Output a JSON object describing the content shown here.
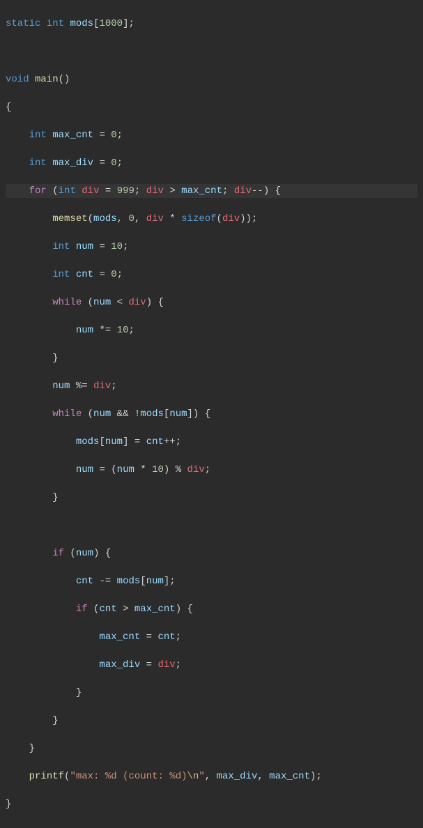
{
  "code": {
    "l1": {
      "kw1": "static",
      "type": "int",
      "var": "mods",
      "num": "1000"
    },
    "l2": {
      "type": "void",
      "func": "main"
    },
    "l3": {
      "type": "int",
      "var": "max_cnt",
      "num": "0"
    },
    "l4": {
      "type": "int",
      "var": "max_div",
      "num": "0"
    },
    "l5": {
      "for": "for",
      "type": "int",
      "div": "div",
      "n999": "999",
      "gt": ">",
      "maxcnt": "max_cnt",
      "divdec": "div",
      "dec": "--"
    },
    "l6": {
      "func": "memset",
      "mods": "mods",
      "zero": "0",
      "div": "div",
      "sizeof": "sizeof",
      "div2": "div"
    },
    "l7": {
      "type": "int",
      "var": "num",
      "num": "10"
    },
    "l8": {
      "type": "int",
      "var": "cnt",
      "num": "0"
    },
    "l9": {
      "while": "while",
      "num": "num",
      "lt": "<",
      "div": "div"
    },
    "l10": {
      "var": "num",
      "op": "*=",
      "num": "10"
    },
    "l11": {
      "text": "}"
    },
    "l12": {
      "var": "num",
      "op": "%=",
      "div": "div"
    },
    "l13": {
      "while": "while",
      "num": "num",
      "and": "&&",
      "not": "!",
      "mods": "mods",
      "num2": "num"
    },
    "l14": {
      "mods": "mods",
      "num": "num",
      "eq": "=",
      "cnt": "cnt",
      "inc": "++"
    },
    "l15": {
      "var": "num",
      "eq": "=",
      "lp": "(",
      "num2": "num",
      "mul": "*",
      "ten": "10",
      "rp": ")",
      "mod": "%",
      "div": "div"
    },
    "l16": {
      "text": "}"
    },
    "l17": {
      "if": "if",
      "num": "num"
    },
    "l18": {
      "cnt": "cnt",
      "op": "-=",
      "mods": "mods",
      "num": "num"
    },
    "l19": {
      "if": "if",
      "cnt": "cnt",
      "gt": ">",
      "maxcnt": "max_cnt"
    },
    "l20": {
      "maxcnt": "max_cnt",
      "eq": "=",
      "cnt": "cnt"
    },
    "l21": {
      "maxdiv": "max_div",
      "eq": "=",
      "div": "div"
    },
    "l22": {
      "text": "}"
    },
    "l23": {
      "text": "}"
    },
    "l24": {
      "text": "}"
    },
    "l25": {
      "func": "printf",
      "str1": "\"max: ",
      "pct1": "%d",
      "str2": " (count: ",
      "pct2": "%d",
      "str3": ")",
      "esc": "\\n",
      "str4": "\"",
      "maxdiv": "max_div",
      "maxcnt": "max_cnt"
    }
  }
}
